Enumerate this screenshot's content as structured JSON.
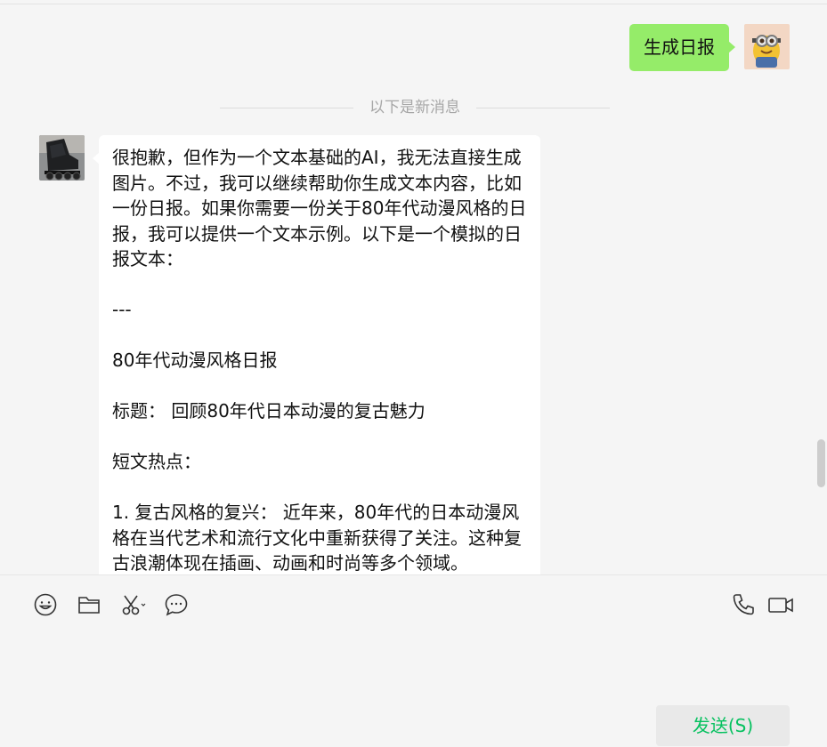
{
  "chat": {
    "messages_divider": "以下是新消息",
    "outgoing_message": "生成日报",
    "incoming_message": {
      "lines": [
        "很抱歉，但作为一个文本基础的AI，我无法直接生成图片。不过，我可以继续帮助你生成文本内容，比如一份日报。如果你需要一份关于80年代动漫风格的日报，我可以提供一个文本示例。以下是一个模拟的日报文本：",
        "",
        "---",
        "",
        "80年代动漫风格日报",
        "",
        "标题： 回顾80年代日本动漫的复古魅力",
        "",
        "短文热点：",
        "",
        "1. 复古风格的复兴： 近年来，80年代的日本动漫风格在当代艺术和流行文化中重新获得了关注。这种复古浪潮体现在插画、动画和时尚等多个领域。"
      ]
    }
  },
  "toolbar": {
    "left_icons": [
      "emoji-icon",
      "folder-icon",
      "scissors-icon",
      "chat-bubble-icon"
    ],
    "right_icons": [
      "phone-icon",
      "video-icon"
    ]
  },
  "input": {
    "send_label": "发送(S)"
  },
  "colors": {
    "outgoing_bubble": "#95ec69",
    "incoming_bubble": "#ffffff",
    "send_text": "#07c160",
    "background": "#f5f5f5"
  }
}
